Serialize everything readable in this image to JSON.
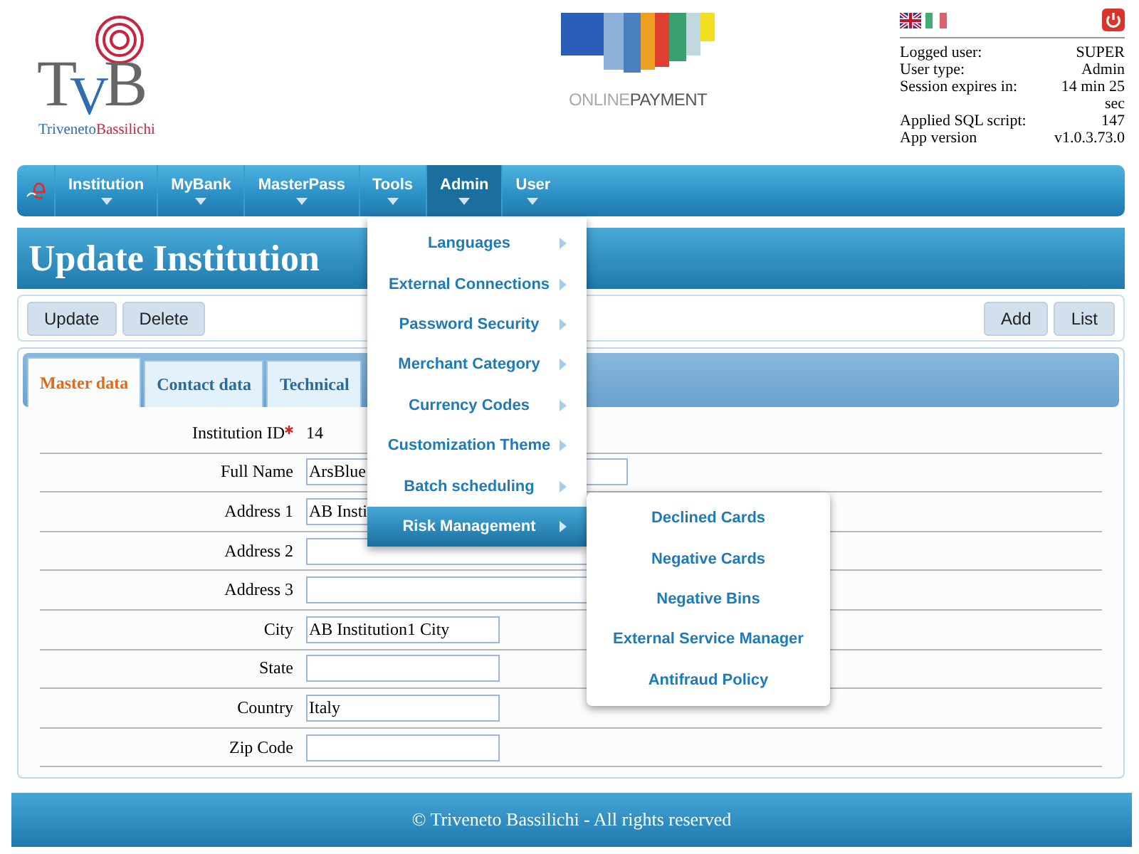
{
  "header": {
    "logo": {
      "letters": [
        "T",
        "V",
        "B"
      ],
      "wordmark": [
        "Triveneto",
        "Bassilichi"
      ]
    },
    "banner": {
      "caption": [
        "ONLINE",
        "PAYMENT"
      ]
    },
    "languages": [
      {
        "kind": "uk",
        "selected": true
      },
      {
        "kind": "italy",
        "selected": false
      }
    ],
    "session": [
      {
        "label": "Logged user:",
        "value": "SUPER"
      },
      {
        "label": "User type:",
        "value": "Admin"
      },
      {
        "label": "Session expires in:",
        "value": "14 min 25 sec"
      },
      {
        "label": "Applied SQL script:",
        "value": "147"
      },
      {
        "label": "App version",
        "value": "v1.0.3.73.0"
      }
    ]
  },
  "nav": {
    "items": [
      {
        "label": "Institution",
        "selected": false
      },
      {
        "label": "MyBank",
        "selected": false
      },
      {
        "label": "MasterPass",
        "selected": false
      },
      {
        "label": "Tools",
        "selected": false
      },
      {
        "label": "Admin",
        "selected": true
      },
      {
        "label": "User",
        "selected": false
      }
    ],
    "menu": [
      {
        "label": "Languages",
        "selected": false
      },
      {
        "label": "External Connections",
        "selected": false
      },
      {
        "label": "Password Security",
        "selected": false
      },
      {
        "label": "Merchant Category",
        "selected": false
      },
      {
        "label": "Currency Codes",
        "selected": false
      },
      {
        "label": "Customization Theme",
        "selected": false
      },
      {
        "label": "Batch scheduling",
        "selected": false
      },
      {
        "label": "Risk Management",
        "selected": true
      }
    ],
    "submenu": [
      {
        "label": "Declined Cards"
      },
      {
        "label": "Negative Cards"
      },
      {
        "label": "Negative Bins"
      },
      {
        "label": "External Service Manager"
      },
      {
        "label": "Antifraud Policy"
      }
    ]
  },
  "page_title": "Update Institution",
  "toolbar": {
    "left": [
      "Update",
      "Delete"
    ],
    "right": [
      "Add",
      "List"
    ]
  },
  "tabs": [
    {
      "label": "Master data",
      "selected": true
    },
    {
      "label": "Contact data",
      "selected": false
    },
    {
      "label": "Technical",
      "selected": false
    }
  ],
  "form": [
    {
      "label": "Institution ID",
      "kind": "static",
      "required": true,
      "value": "14"
    },
    {
      "label": "Full Name",
      "kind": "wide",
      "required": false,
      "value": "ArsBlue"
    },
    {
      "label": "Address 1",
      "kind": "wide",
      "required": false,
      "value": "AB Insti"
    },
    {
      "label": "Address 2",
      "kind": "wide",
      "required": false
    },
    {
      "label": "Address 3",
      "kind": "wide",
      "required": false
    },
    {
      "label": "City",
      "kind": "narrow",
      "required": false,
      "value": "AB Institution1 City"
    },
    {
      "label": "State",
      "kind": "narrow",
      "required": false
    },
    {
      "label": "Country",
      "kind": "narrow",
      "required": false,
      "value": "Italy"
    },
    {
      "label": "Zip Code",
      "kind": "narrow",
      "required": false
    }
  ],
  "footer": "© Triveneto Bassilichi - All rights reserved"
}
